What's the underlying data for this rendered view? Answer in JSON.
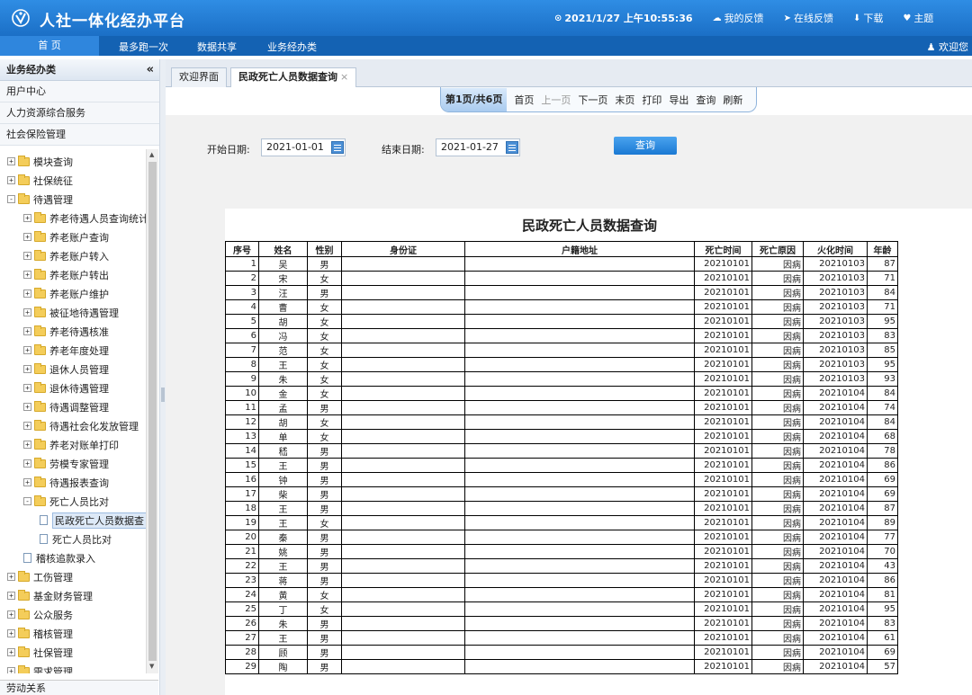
{
  "app": {
    "title": "人社一体化经办平台",
    "datetime": "2021/1/27 上午10:55:36",
    "top_links": [
      {
        "label": "我的反馈",
        "icon": "chat-icon"
      },
      {
        "label": "在线反馈",
        "icon": "send-icon"
      },
      {
        "label": "下载",
        "icon": "download-icon"
      },
      {
        "label": "主题",
        "icon": "heart-icon"
      }
    ],
    "colors": {
      "header": "#1b6fc6",
      "nav": "#1462b3",
      "accent": "#2f86dd"
    }
  },
  "nav": {
    "items": [
      "首 页",
      "最多跑一次",
      "数据共享",
      "业务经办类"
    ],
    "welcome": "欢迎您"
  },
  "sidebar": {
    "header": "业务经办类",
    "menus": [
      "用户中心",
      "人力资源综合服务",
      "社会保险管理"
    ],
    "tree": [
      {
        "label": "模块查询",
        "level": 0,
        "type": "folder",
        "exp": "+"
      },
      {
        "label": "社保统征",
        "level": 0,
        "type": "folder",
        "exp": "+"
      },
      {
        "label": "待遇管理",
        "level": 0,
        "type": "folder",
        "exp": "-"
      },
      {
        "label": "养老待遇人员查询统计",
        "level": 1,
        "type": "folder",
        "exp": "+"
      },
      {
        "label": "养老账户查询",
        "level": 1,
        "type": "folder",
        "exp": "+"
      },
      {
        "label": "养老账户转入",
        "level": 1,
        "type": "folder",
        "exp": "+"
      },
      {
        "label": "养老账户转出",
        "level": 1,
        "type": "folder",
        "exp": "+"
      },
      {
        "label": "养老账户维护",
        "level": 1,
        "type": "folder",
        "exp": "+"
      },
      {
        "label": "被征地待遇管理",
        "level": 1,
        "type": "folder",
        "exp": "+"
      },
      {
        "label": "养老待遇核准",
        "level": 1,
        "type": "folder",
        "exp": "+"
      },
      {
        "label": "养老年度处理",
        "level": 1,
        "type": "folder",
        "exp": "+"
      },
      {
        "label": "退休人员管理",
        "level": 1,
        "type": "folder",
        "exp": "+"
      },
      {
        "label": "退休待遇管理",
        "level": 1,
        "type": "folder",
        "exp": "+"
      },
      {
        "label": "待遇调整管理",
        "level": 1,
        "type": "folder",
        "exp": "+"
      },
      {
        "label": "待遇社会化发放管理",
        "level": 1,
        "type": "folder",
        "exp": "+"
      },
      {
        "label": "养老对账单打印",
        "level": 1,
        "type": "folder",
        "exp": "+"
      },
      {
        "label": "劳模专家管理",
        "level": 1,
        "type": "folder",
        "exp": "+"
      },
      {
        "label": "待遇报表查询",
        "level": 1,
        "type": "folder",
        "exp": "+"
      },
      {
        "label": "死亡人员比对",
        "level": 1,
        "type": "folder",
        "exp": "-"
      },
      {
        "label": "民政死亡人员数据查",
        "level": 2,
        "type": "doc",
        "selected": true
      },
      {
        "label": "死亡人员比对",
        "level": 2,
        "type": "doc"
      },
      {
        "label": "稽核追款录入",
        "level": 1,
        "type": "doc"
      },
      {
        "label": "工伤管理",
        "level": 0,
        "type": "folder",
        "exp": "+"
      },
      {
        "label": "基金财务管理",
        "level": 0,
        "type": "folder",
        "exp": "+"
      },
      {
        "label": "公众服务",
        "level": 0,
        "type": "folder",
        "exp": "+"
      },
      {
        "label": "稽核管理",
        "level": 0,
        "type": "folder",
        "exp": "+"
      },
      {
        "label": "社保管理",
        "level": 0,
        "type": "folder",
        "exp": "+"
      },
      {
        "label": "需求管理",
        "level": 0,
        "type": "folder",
        "exp": "+"
      }
    ],
    "footer": "劳动关系"
  },
  "tabs": [
    {
      "label": "欢迎界面",
      "active": false
    },
    {
      "label": "民政死亡人员数据查询",
      "active": true,
      "close": "×"
    }
  ],
  "pager": {
    "info": "第1页/共6页",
    "buttons": [
      {
        "label": "首页",
        "disabled": false
      },
      {
        "label": "上一页",
        "disabled": true
      },
      {
        "label": "下一页",
        "disabled": false
      },
      {
        "label": "末页",
        "disabled": false
      },
      {
        "label": "打印",
        "disabled": false
      },
      {
        "label": "导出",
        "disabled": false
      },
      {
        "label": "查询",
        "disabled": false
      },
      {
        "label": "刷新",
        "disabled": false
      }
    ]
  },
  "search": {
    "start_label": "开始日期:",
    "start_value": "2021-01-01",
    "end_label": "结束日期:",
    "end_value": "2021-01-27",
    "query_button": "查询"
  },
  "report": {
    "title": "民政死亡人员数据查询",
    "columns": [
      "序号",
      "姓名",
      "性别",
      "身份证",
      "户籍地址",
      "死亡时间",
      "死亡原因",
      "火化时间",
      "年龄"
    ],
    "rows": [
      [
        "1",
        "吴",
        "男",
        "",
        "",
        "20210101",
        "因病",
        "20210103",
        "87"
      ],
      [
        "2",
        "宋",
        "女",
        "",
        "",
        "20210101",
        "因病",
        "20210103",
        "71"
      ],
      [
        "3",
        "汪",
        "男",
        "",
        "",
        "20210101",
        "因病",
        "20210103",
        "84"
      ],
      [
        "4",
        "曹",
        "女",
        "",
        "",
        "20210101",
        "因病",
        "20210103",
        "71"
      ],
      [
        "5",
        "胡",
        "女",
        "",
        "",
        "20210101",
        "因病",
        "20210103",
        "95"
      ],
      [
        "6",
        "冯",
        "女",
        "",
        "",
        "20210101",
        "因病",
        "20210103",
        "83"
      ],
      [
        "7",
        "范",
        "女",
        "",
        "",
        "20210101",
        "因病",
        "20210103",
        "85"
      ],
      [
        "8",
        "王",
        "女",
        "",
        "",
        "20210101",
        "因病",
        "20210103",
        "95"
      ],
      [
        "9",
        "朱",
        "女",
        "",
        "",
        "20210101",
        "因病",
        "20210103",
        "93"
      ],
      [
        "10",
        "金",
        "女",
        "",
        "",
        "20210101",
        "因病",
        "20210104",
        "84"
      ],
      [
        "11",
        "孟",
        "男",
        "",
        "",
        "20210101",
        "因病",
        "20210104",
        "74"
      ],
      [
        "12",
        "胡",
        "女",
        "",
        "",
        "20210101",
        "因病",
        "20210104",
        "84"
      ],
      [
        "13",
        "单",
        "女",
        "",
        "",
        "20210101",
        "因病",
        "20210104",
        "68"
      ],
      [
        "14",
        "嵇",
        "男",
        "",
        "",
        "20210101",
        "因病",
        "20210104",
        "78"
      ],
      [
        "15",
        "王",
        "男",
        "",
        "",
        "20210101",
        "因病",
        "20210104",
        "86"
      ],
      [
        "16",
        "钟",
        "男",
        "",
        "",
        "20210101",
        "因病",
        "20210104",
        "69"
      ],
      [
        "17",
        "柴",
        "男",
        "",
        "",
        "20210101",
        "因病",
        "20210104",
        "69"
      ],
      [
        "18",
        "王",
        "男",
        "",
        "",
        "20210101",
        "因病",
        "20210104",
        "87"
      ],
      [
        "19",
        "王",
        "女",
        "",
        "",
        "20210101",
        "因病",
        "20210104",
        "89"
      ],
      [
        "20",
        "秦",
        "男",
        "",
        "",
        "20210101",
        "因病",
        "20210104",
        "77"
      ],
      [
        "21",
        "姚",
        "男",
        "",
        "",
        "20210101",
        "因病",
        "20210104",
        "70"
      ],
      [
        "22",
        "王",
        "男",
        "",
        "",
        "20210101",
        "因病",
        "20210104",
        "43"
      ],
      [
        "23",
        "蒋",
        "男",
        "",
        "",
        "20210101",
        "因病",
        "20210104",
        "86"
      ],
      [
        "24",
        "黄",
        "女",
        "",
        "",
        "20210101",
        "因病",
        "20210104",
        "81"
      ],
      [
        "25",
        "丁",
        "女",
        "",
        "",
        "20210101",
        "因病",
        "20210104",
        "95"
      ],
      [
        "26",
        "朱",
        "男",
        "",
        "",
        "20210101",
        "因病",
        "20210104",
        "83"
      ],
      [
        "27",
        "王",
        "男",
        "",
        "",
        "20210101",
        "因病",
        "20210104",
        "61"
      ],
      [
        "28",
        "顾",
        "男",
        "",
        "",
        "20210101",
        "因病",
        "20210104",
        "69"
      ],
      [
        "29",
        "陶",
        "男",
        "",
        "",
        "20210101",
        "因病",
        "20210104",
        "57"
      ]
    ]
  }
}
